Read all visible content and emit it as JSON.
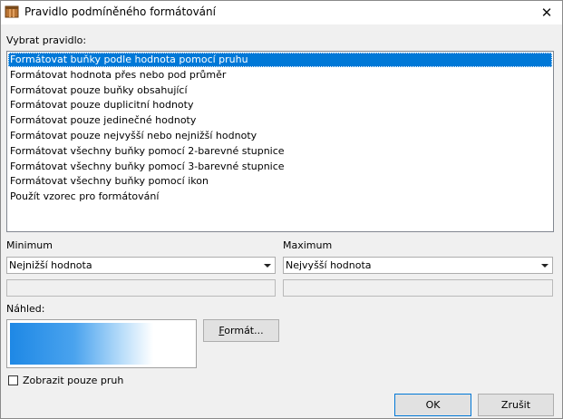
{
  "window": {
    "title": "Pravidlo podmíněného formátování",
    "close_glyph": "✕"
  },
  "rules": {
    "label": "Vybrat pravidlo:",
    "items": [
      "Formátovat buňky podle hodnota pomocí pruhu",
      "Formátovat hodnota přes nebo pod průměr",
      "Formátovat pouze buňky obsahující",
      "Formátovat pouze duplicitní hodnoty",
      "Formátovat pouze jedinečné hodnoty",
      "Formátovat pouze nejvyšší nebo nejnižší hodnoty",
      "Formátovat všechny buňky pomocí 2-barevné stupnice",
      "Formátovat všechny buňky pomocí 3-barevné stupnice",
      "Formátovat všechny buňky pomocí ikon",
      "Použít vzorec pro formátování"
    ],
    "selected_index": 0
  },
  "minimum": {
    "label": "Minimum",
    "value": "Nejnižší hodnota",
    "field_value": ""
  },
  "maximum": {
    "label": "Maximum",
    "value": "Nejvyšší hodnota",
    "field_value": ""
  },
  "preview": {
    "label": "Náhled:",
    "bar_fill_fraction": 0.78,
    "colors": {
      "bar_start": "#1e88e5",
      "bar_end": "#ffffff"
    }
  },
  "format_button": {
    "accel": "F",
    "rest": "ormát..."
  },
  "show_bar_only": {
    "label": "Zobrazit pouze pruh",
    "checked": false
  },
  "buttons": {
    "ok": "OK",
    "cancel": "Zrušit"
  },
  "colors": {
    "selection": "#0078d7",
    "window_bg": "#f0f0f0"
  }
}
